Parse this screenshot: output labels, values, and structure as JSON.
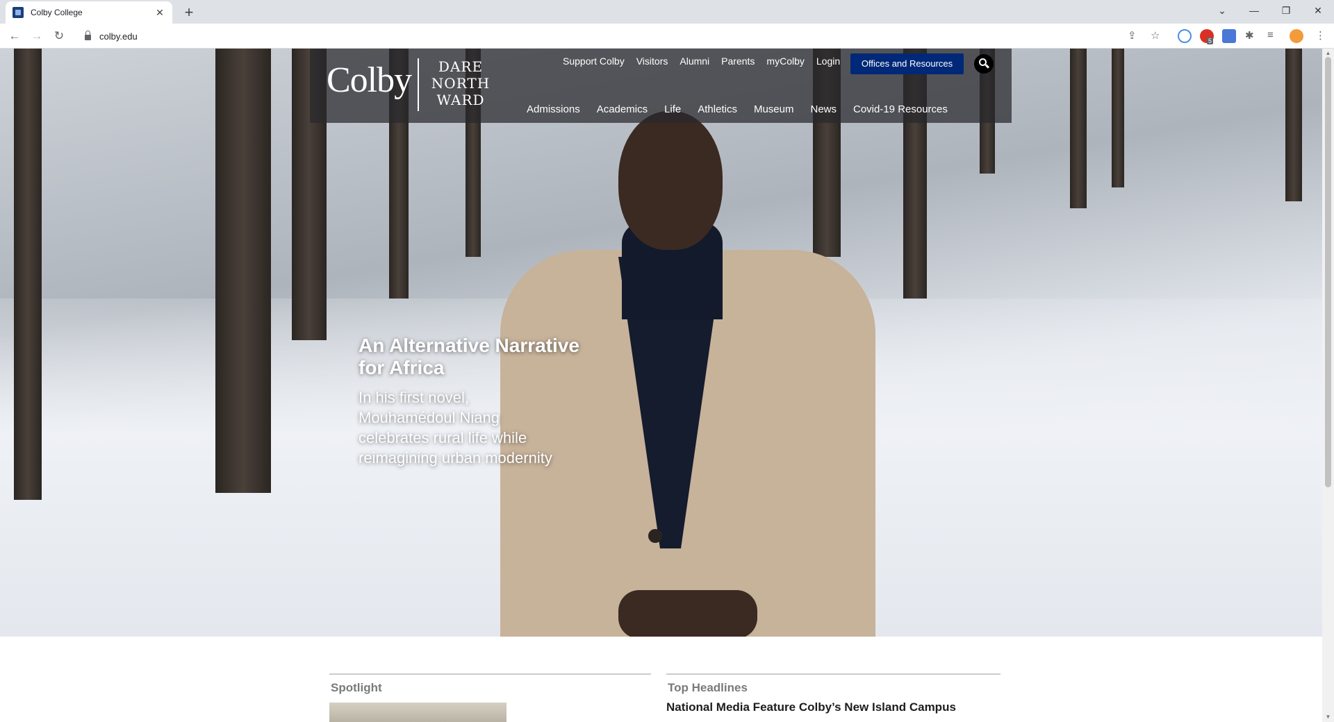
{
  "browser": {
    "tab_title": "Colby College",
    "url": "colby.edu",
    "new_tab": "+",
    "ext_badge": "5"
  },
  "site": {
    "logo_text": "Colby",
    "tagline_lines": [
      "DARE",
      "NORTH",
      "WARD"
    ],
    "utility_nav": [
      "Support Colby",
      "Visitors",
      "Alumni",
      "Parents",
      "myColby",
      "Login"
    ],
    "offices_button": "Offices and Resources",
    "main_nav": [
      "Admissions",
      "Academics",
      "Life",
      "Athletics",
      "Museum",
      "News",
      "Covid-19 Resources"
    ]
  },
  "hero": {
    "title": "An Alternative Narrative for Africa",
    "subtitle": "In his first novel, Mouhamédoul Niang celebrates rural life while reimagining urban modernity"
  },
  "sections": {
    "spotlight_label": "Spotlight",
    "top_headlines_label": "Top Headlines",
    "headline_1": "National Media Feature Colby’s New Island Campus"
  },
  "colors": {
    "offices_button_bg": "#002878",
    "tabstrip_bg": "#dee1e6"
  }
}
